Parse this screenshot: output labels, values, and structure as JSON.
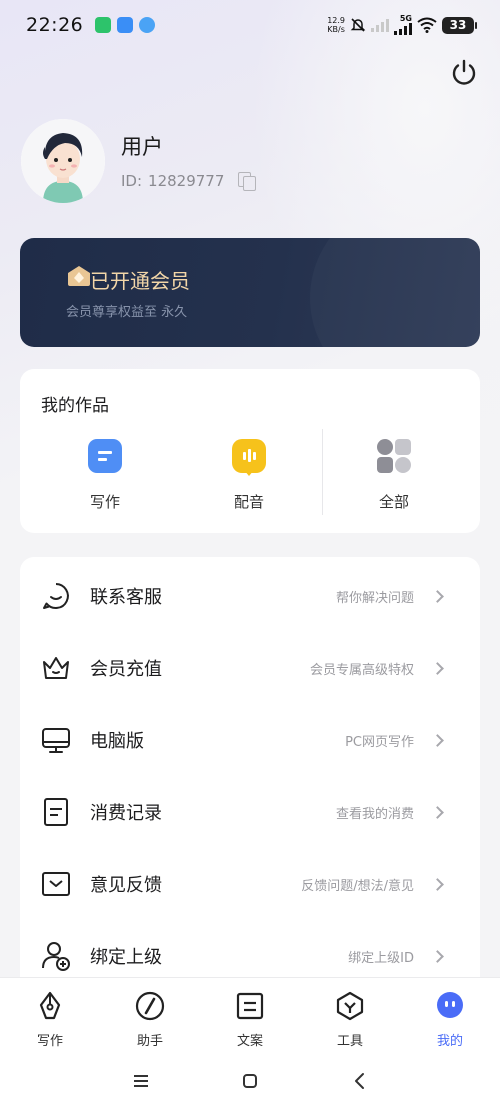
{
  "status_bar": {
    "time": "22:26",
    "net_speed_value": "12.9",
    "net_speed_unit": "KB/s",
    "network_type": "5G",
    "battery": "33"
  },
  "profile": {
    "username": "用户",
    "id_label": "ID:",
    "id_value": "12829777"
  },
  "member": {
    "title": "已开通会员",
    "subtitle": "会员尊享权益至 永久",
    "accent_color": "#f2d6a8"
  },
  "works": {
    "title": "我的作品",
    "items": [
      {
        "label": "写作",
        "icon": "document-icon",
        "color": "#4f8ef5"
      },
      {
        "label": "配音",
        "icon": "voice-icon",
        "color": "#f6c21b"
      },
      {
        "label": "全部",
        "icon": "grid-icon",
        "color": "#8f8f97"
      }
    ]
  },
  "menu": [
    {
      "label": "联系客服",
      "hint": "帮你解决问题",
      "icon": "chat-icon"
    },
    {
      "label": "会员充值",
      "hint": "会员专属高级特权",
      "icon": "crown-icon"
    },
    {
      "label": "电脑版",
      "hint": "PC网页写作",
      "icon": "monitor-icon"
    },
    {
      "label": "消费记录",
      "hint": "查看我的消费",
      "icon": "record-icon"
    },
    {
      "label": "意见反馈",
      "hint": "反馈问题/想法/意见",
      "icon": "feedback-icon"
    },
    {
      "label": "绑定上级",
      "hint": "绑定上级ID",
      "icon": "add-user-icon"
    }
  ],
  "tabs": [
    {
      "label": "写作",
      "icon": "pen-icon"
    },
    {
      "label": "助手",
      "icon": "compass-icon"
    },
    {
      "label": "文案",
      "icon": "doc-icon"
    },
    {
      "label": "工具",
      "icon": "tool-icon"
    },
    {
      "label": "我的",
      "icon": "me-icon",
      "active": true
    }
  ],
  "active_color": "#4a6cf7"
}
